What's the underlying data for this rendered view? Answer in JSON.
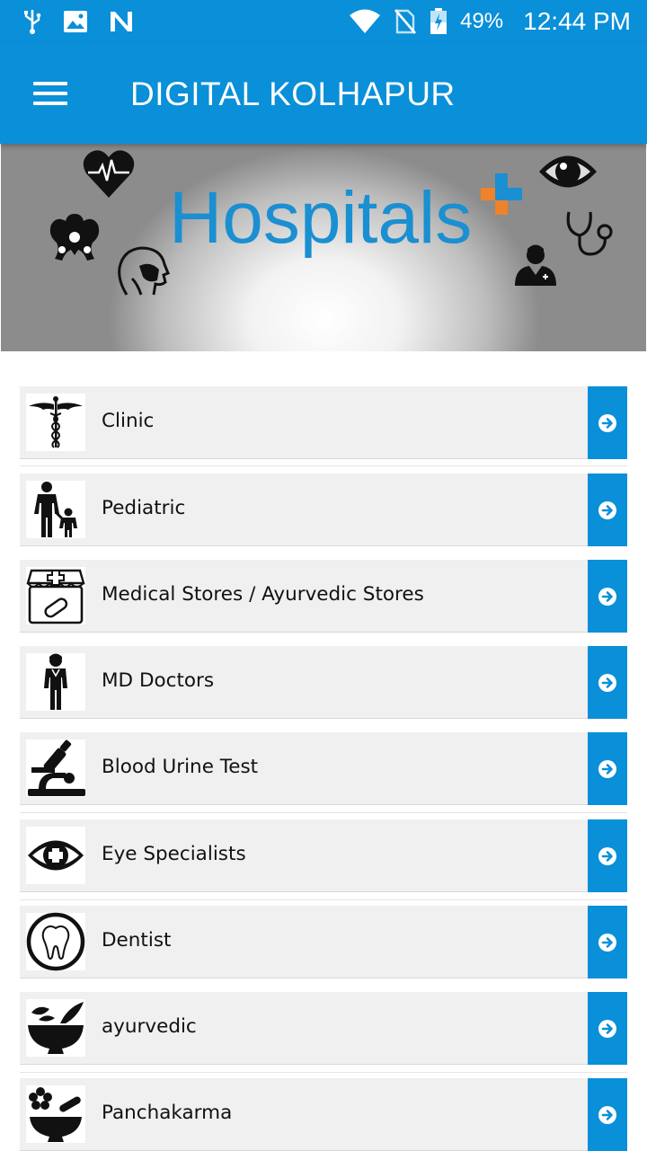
{
  "status_bar": {
    "battery_percent": "49%",
    "time": "12:44 PM",
    "left_icons": [
      "usb-icon",
      "image-icon",
      "n-notification-icon"
    ],
    "right_icons": [
      "wifi-icon",
      "no-sim-icon",
      "battery-icon"
    ]
  },
  "app_bar": {
    "title": "DIGITAL KOLHAPUR",
    "menu_icon": "hamburger-menu-icon"
  },
  "banner": {
    "title": "Hospitals",
    "icons": [
      "heart-pulse-icon",
      "pelvis-icon",
      "head-anatomy-icon",
      "medical-plus-icon",
      "eye-icon",
      "stethoscope-icon",
      "doctor-icon"
    ],
    "colors": {
      "title": "#1a8fd1",
      "plus_orange": "#f0822a",
      "plus_blue": "#1a8fd1"
    }
  },
  "categories": [
    {
      "label": "Clinic",
      "icon": "caduceus-icon"
    },
    {
      "label": "Pediatric",
      "icon": "parent-child-icon"
    },
    {
      "label": "Medical Stores / Ayurvedic Stores",
      "icon": "pharmacy-store-icon"
    },
    {
      "label": "MD Doctors",
      "icon": "doctor-figure-icon"
    },
    {
      "label": "Blood Urine Test",
      "icon": "microscope-icon"
    },
    {
      "label": "Eye Specialists",
      "icon": "eye-plus-icon"
    },
    {
      "label": "Dentist",
      "icon": "tooth-icon"
    },
    {
      "label": "ayurvedic",
      "icon": "mortar-pestle-icon"
    },
    {
      "label": "Panchakarma",
      "icon": "flower-mortar-icon"
    }
  ],
  "colors": {
    "accent": "#0a8fd9",
    "row_bg": "#f0f0f0"
  }
}
